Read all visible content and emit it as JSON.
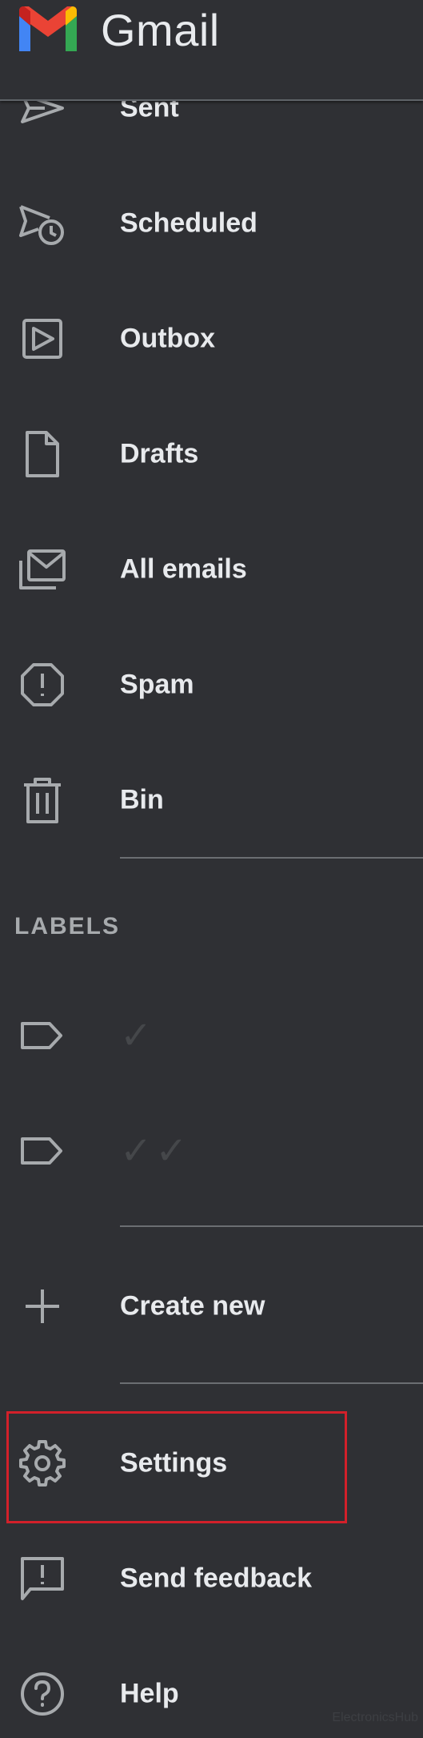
{
  "app": {
    "title": "Gmail"
  },
  "nav": {
    "sent": "Sent",
    "scheduled": "Scheduled",
    "outbox": "Outbox",
    "drafts": "Drafts",
    "all_emails": "All emails",
    "spam": "Spam",
    "bin": "Bin"
  },
  "labels_section": {
    "title": "LABELS",
    "items": [
      {
        "label": "✓",
        "icon": "label-icon"
      },
      {
        "label": "✓✓",
        "icon": "label-icon"
      }
    ]
  },
  "actions": {
    "create_new": "Create new",
    "settings": "Settings",
    "send_feedback": "Send feedback",
    "help": "Help"
  },
  "highlight": {
    "target": "Settings",
    "color": "#d3202a"
  },
  "watermark": "ElectronicsHub",
  "colors": {
    "background": "#2f3034",
    "text": "#e8eaed",
    "icon": "#a7aaad",
    "divider": "#6b6e72"
  }
}
